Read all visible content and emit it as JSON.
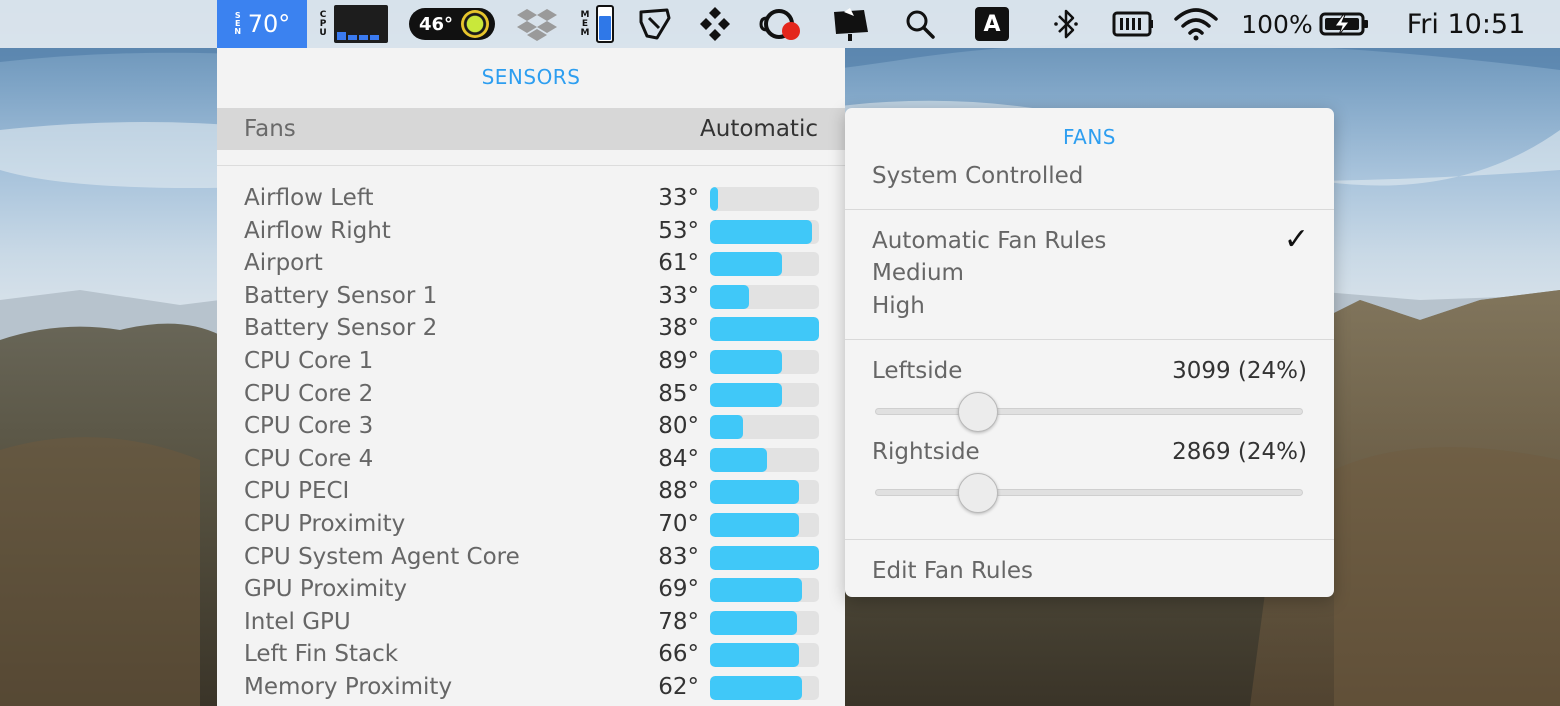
{
  "menubar": {
    "sensor_label": "SEN",
    "sensor_temp": "70°",
    "cpu_label": "CPU",
    "gpu_temp": "46°",
    "mem_label": "MEM",
    "input_source": "A",
    "battery_percent": "100%",
    "clock": "Fri 10:51",
    "colors": {
      "highlight": "#3b82f0"
    }
  },
  "sensors_panel": {
    "title": "SENSORS",
    "fans_label": "Fans",
    "fans_mode": "Automatic",
    "sensors": [
      {
        "name": "Airflow Left",
        "temp": "33°",
        "level": 0.07
      },
      {
        "name": "Airflow Right",
        "temp": "53°",
        "level": 0.94
      },
      {
        "name": "Airport",
        "temp": "61°",
        "level": 0.66
      },
      {
        "name": "Battery Sensor 1",
        "temp": "33°",
        "level": 0.36
      },
      {
        "name": "Battery Sensor 2",
        "temp": "38°",
        "level": 1.0
      },
      {
        "name": "CPU Core 1",
        "temp": "89°",
        "level": 0.66
      },
      {
        "name": "CPU Core 2",
        "temp": "85°",
        "level": 0.66
      },
      {
        "name": "CPU Core 3",
        "temp": "80°",
        "level": 0.3
      },
      {
        "name": "CPU Core 4",
        "temp": "84°",
        "level": 0.52
      },
      {
        "name": "CPU PECI",
        "temp": "88°",
        "level": 0.82
      },
      {
        "name": "CPU Proximity",
        "temp": "70°",
        "level": 0.82
      },
      {
        "name": "CPU System Agent Core",
        "temp": "83°",
        "level": 1.0
      },
      {
        "name": "GPU Proximity",
        "temp": "69°",
        "level": 0.84
      },
      {
        "name": "Intel GPU",
        "temp": "78°",
        "level": 0.8
      },
      {
        "name": "Left Fin Stack",
        "temp": "66°",
        "level": 0.82
      },
      {
        "name": "Memory Proximity",
        "temp": "62°",
        "level": 0.84
      }
    ],
    "colors": {
      "bar_fill": "#40c8f8",
      "title": "#2d9ef0"
    }
  },
  "fans_popup": {
    "title": "FANS",
    "system_controlled": "System Controlled",
    "rules": [
      {
        "label": "Automatic Fan Rules",
        "checked": true
      },
      {
        "label": "Medium",
        "checked": false
      },
      {
        "label": "High",
        "checked": false
      }
    ],
    "check_mark": "✓",
    "fans": [
      {
        "name": "Leftside",
        "value": "3099 (24%)",
        "level": 0.24
      },
      {
        "name": "Rightside",
        "value": "2869 (24%)",
        "level": 0.24
      }
    ],
    "edit_rules": "Edit Fan Rules"
  }
}
